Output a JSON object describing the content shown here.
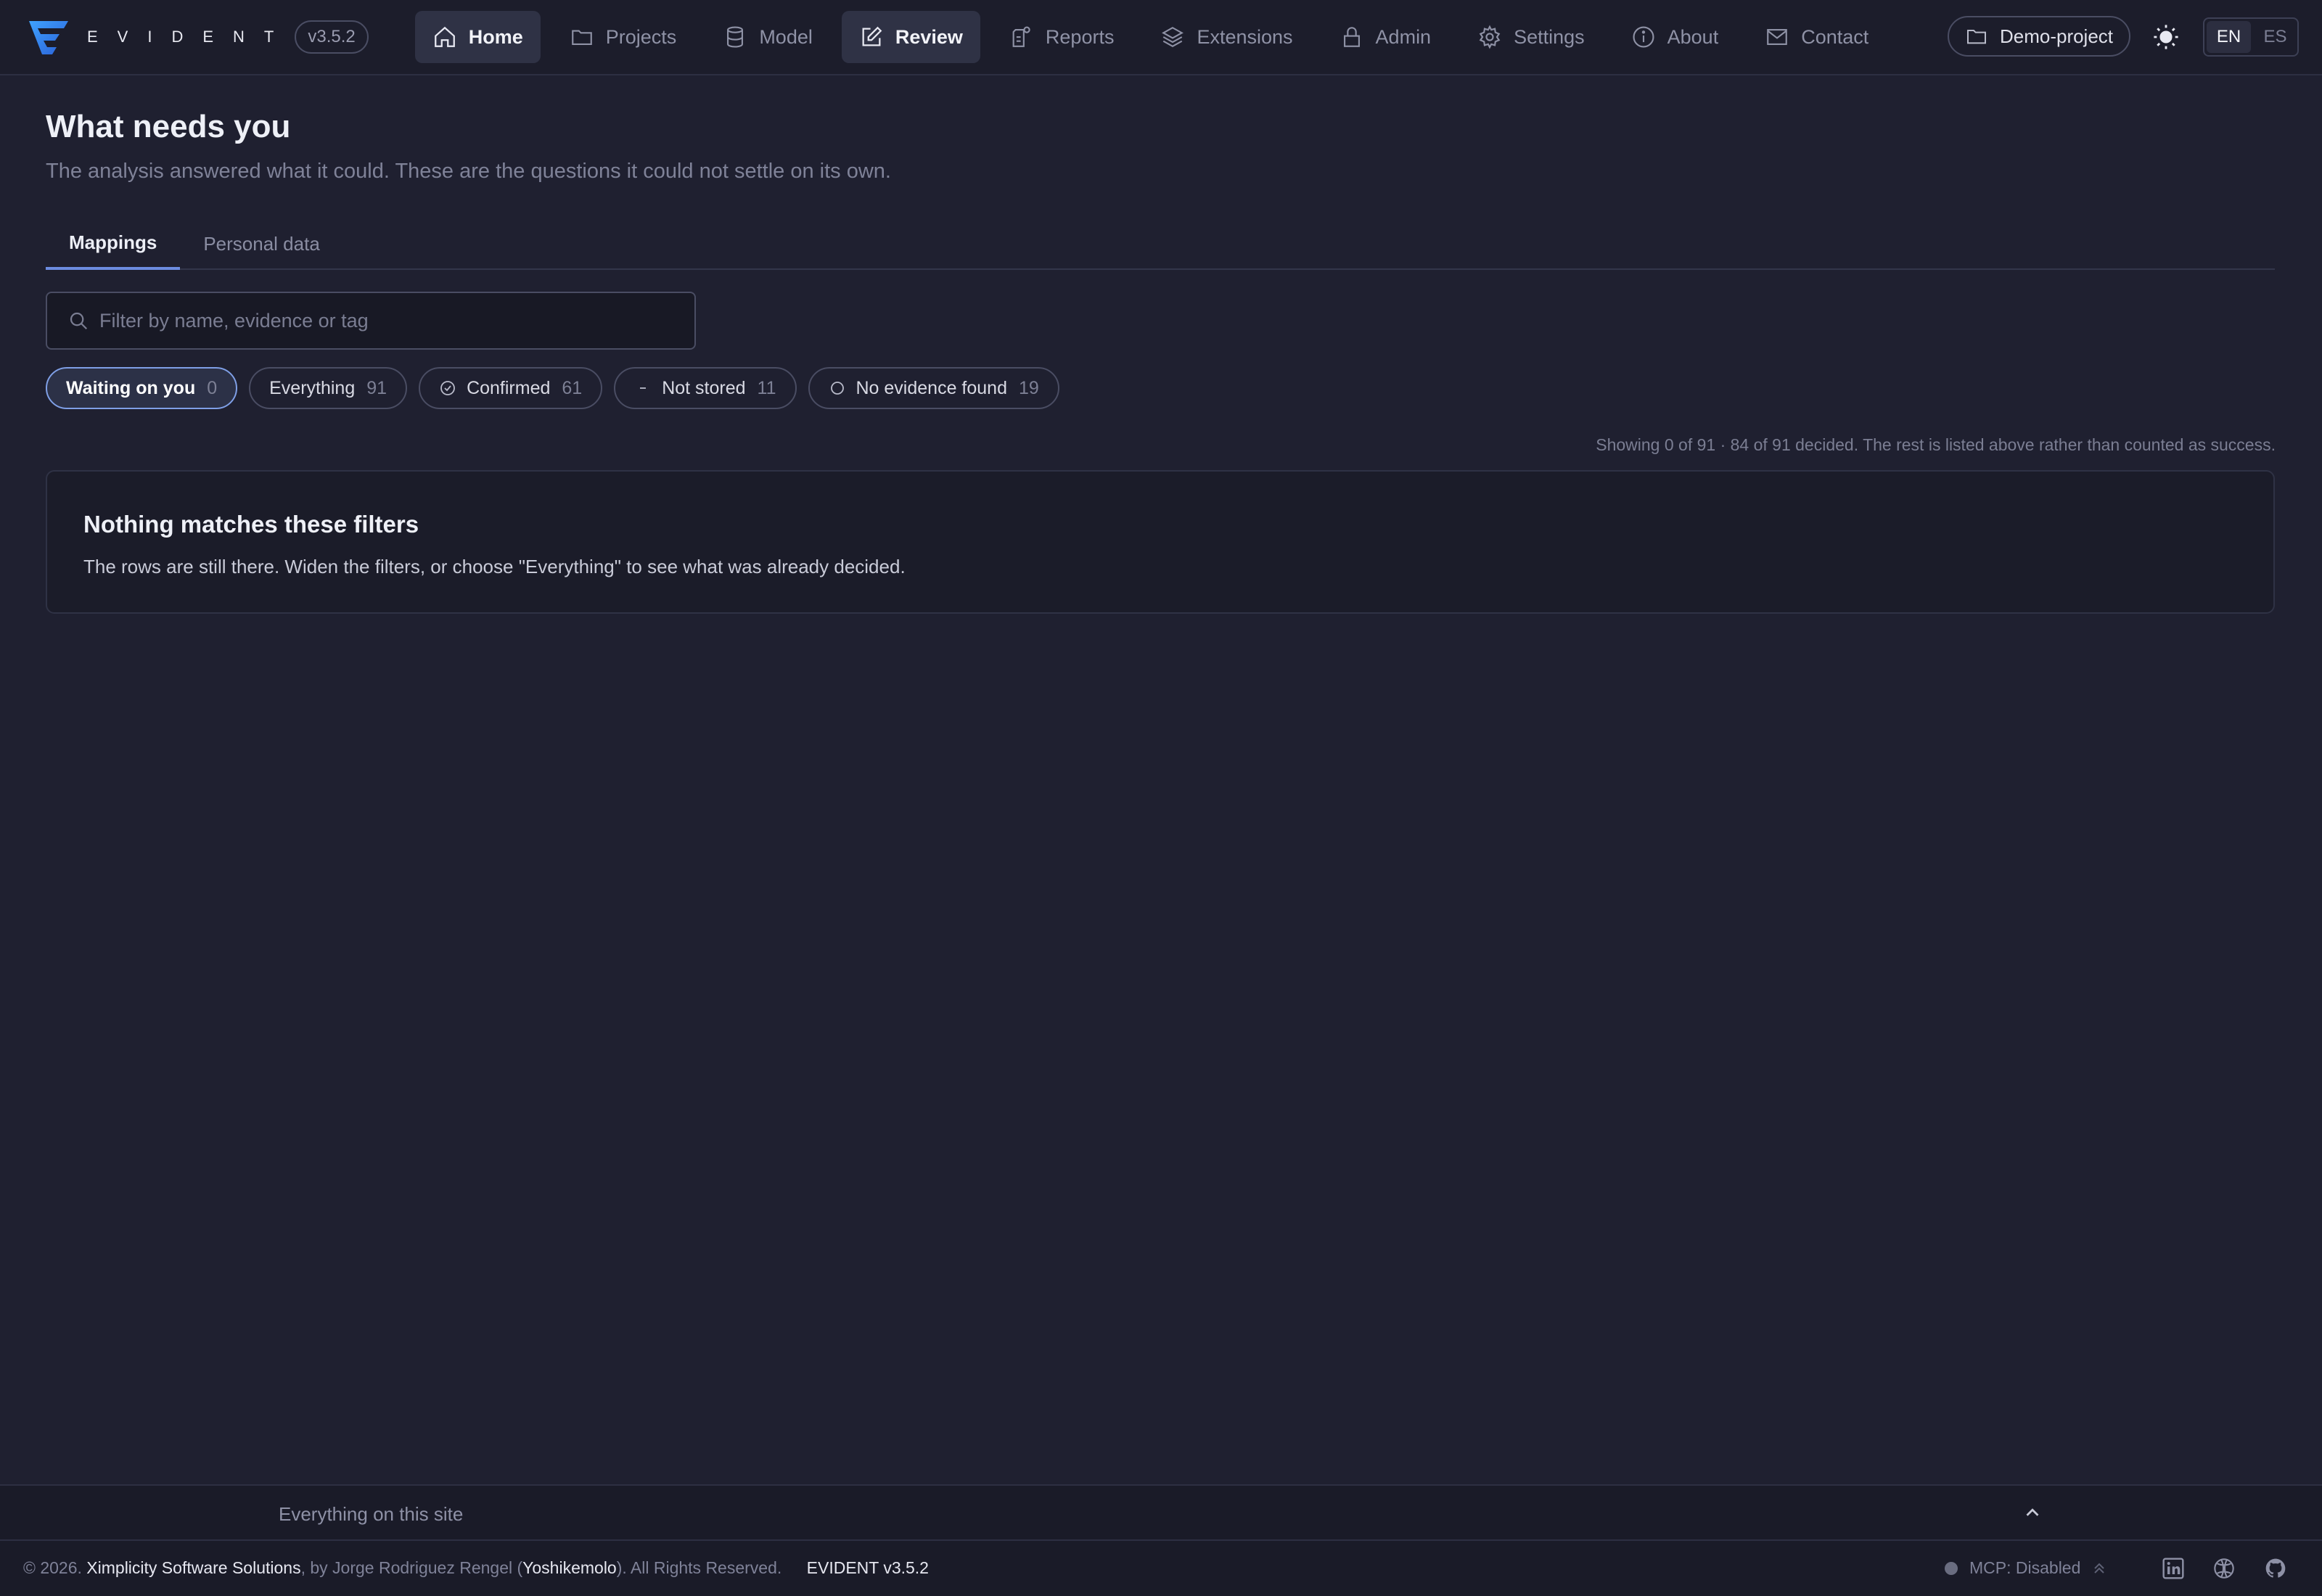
{
  "brand": {
    "name": "EVIDENT",
    "version": "v3.5.2"
  },
  "nav": {
    "items": [
      {
        "label": "Home",
        "icon": "home-icon"
      },
      {
        "label": "Projects",
        "icon": "folder-icon"
      },
      {
        "label": "Model",
        "icon": "database-icon"
      },
      {
        "label": "Review",
        "icon": "edit-icon",
        "active": true
      },
      {
        "label": "Reports",
        "icon": "report-icon"
      },
      {
        "label": "Extensions",
        "icon": "layers-icon"
      },
      {
        "label": "Admin",
        "icon": "lock-icon"
      },
      {
        "label": "Settings",
        "icon": "gear-icon"
      },
      {
        "label": "About",
        "icon": "info-icon"
      },
      {
        "label": "Contact",
        "icon": "mail-icon"
      }
    ]
  },
  "header": {
    "project": "Demo-project",
    "theme_icon": "sun-icon",
    "lang": [
      "EN",
      "ES"
    ],
    "lang_active": "EN"
  },
  "page": {
    "title": "What needs you",
    "subtitle": "The analysis answered what it could. These are the questions it could not settle on its own."
  },
  "tabs": [
    {
      "label": "Mappings",
      "active": true
    },
    {
      "label": "Personal data"
    }
  ],
  "search": {
    "placeholder": "Filter by name, evidence or tag",
    "value": ""
  },
  "filters": [
    {
      "label": "Waiting on you",
      "count": "0",
      "active": true
    },
    {
      "label": "Everything",
      "count": "91"
    },
    {
      "label": "Confirmed",
      "count": "61",
      "icon": "check-circle-icon"
    },
    {
      "label": "Not stored",
      "count": "11",
      "icon": "minus-icon"
    },
    {
      "label": "No evidence found",
      "count": "19",
      "icon": "circle-icon"
    }
  ],
  "status": "Showing 0 of 91 · 84 of 91 decided. The rest is listed above rather than counted as success.",
  "empty": {
    "title": "Nothing matches these filters",
    "text": "The rows are still there. Widen the filters, or choose \"Everything\" to see what was already decided."
  },
  "site_strip": {
    "label": "Everything on this site"
  },
  "footer": {
    "copyright_prefix": "© 2026.",
    "company": "Ximplicity Software Solutions",
    "by_text": ", by Jorge Rodriguez Rengel (",
    "handle": "Yoshikemolo",
    "rights": "). All Rights Reserved.",
    "version": "EVIDENT v3.5.2",
    "mcp": "MCP: Disabled"
  },
  "colors": {
    "accent": "#6c8ce0",
    "background": "#1f2030",
    "topbar": "#1c1d2b"
  }
}
